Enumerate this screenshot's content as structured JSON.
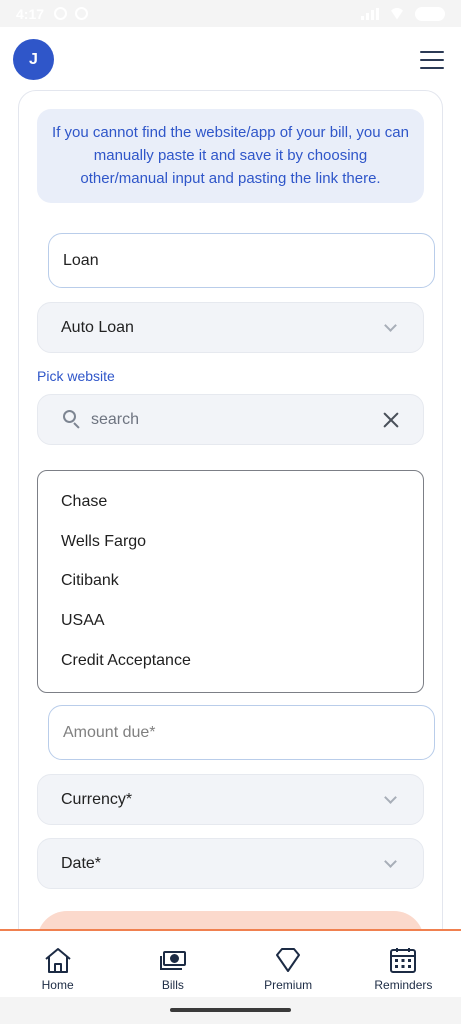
{
  "status_bar": {
    "time": "4:17"
  },
  "header": {
    "avatar_initial": "J"
  },
  "info": {
    "message": "If you cannot find the website/app of your bill, you can manually paste it and save it by choosing other/manual input and pasting the link there."
  },
  "form": {
    "bill_name_value": "Loan",
    "category_value": "Auto Loan",
    "pick_website_label": "Pick website",
    "search_placeholder": "search",
    "websites": [
      "Chase",
      "Wells Fargo",
      "Citibank",
      "USAA",
      "Credit Acceptance"
    ],
    "amount_placeholder": "Amount due*",
    "currency_label": "Currency*",
    "date_label": "Date*"
  },
  "tabs": [
    {
      "label": "Home",
      "icon": "home-icon"
    },
    {
      "label": "Bills",
      "icon": "money-icon"
    },
    {
      "label": "Premium",
      "icon": "diamond-icon"
    },
    {
      "label": "Reminders",
      "icon": "calendar-icon"
    }
  ],
  "colors": {
    "accent": "#2f56c9",
    "tab_border": "#f0804f",
    "info_bg": "#e9eef9",
    "submit_peek": "#fbd9cc"
  }
}
